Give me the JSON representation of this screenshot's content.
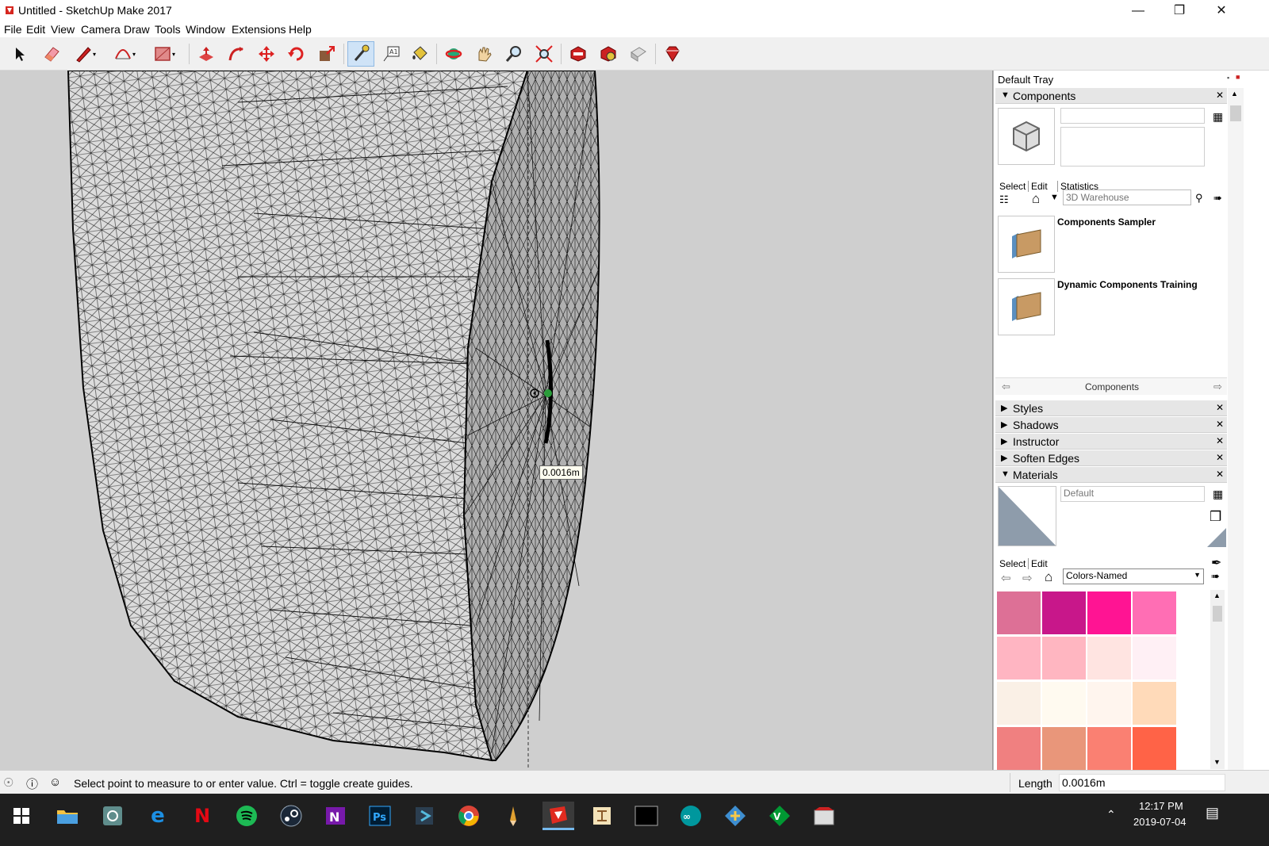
{
  "window": {
    "title": "Untitled - SketchUp Make 2017",
    "minimize_icon": "minimize-icon",
    "maximize_icon": "restore-icon",
    "close_icon": "close-icon"
  },
  "menu": [
    "File",
    "Edit",
    "View",
    "Camera",
    "Draw",
    "Tools",
    "Window",
    "Extensions",
    "Help"
  ],
  "toolbar": {
    "tools": [
      "select",
      "eraser",
      "pencil-line",
      "arc",
      "rectangle",
      "push-pull",
      "follow-me",
      "move",
      "rotate",
      "scale",
      "tape-measure",
      "text",
      "paint-bucket",
      "orbit",
      "pan",
      "zoom",
      "zoom-extents",
      "3d-warehouse",
      "extension-warehouse",
      "layout",
      "ruby"
    ],
    "active_tool": "tape-measure"
  },
  "viewport": {
    "measure_value": "0.0016m"
  },
  "tray": {
    "title": "Default Tray",
    "components": {
      "header": "Components",
      "tabs": [
        "Select",
        "Edit",
        "Statistics"
      ],
      "search_placeholder": "3D Warehouse",
      "items": [
        {
          "name": "Components Sampler"
        },
        {
          "name": "Dynamic Components Training"
        }
      ],
      "footer_label": "Components"
    },
    "collapsed_panels": [
      "Styles",
      "Shadows",
      "Instructor",
      "Soften Edges"
    ],
    "materials": {
      "header": "Materials",
      "name_value": "Default",
      "tabs": [
        "Select",
        "Edit"
      ],
      "library": "Colors-Named",
      "swatches": [
        "#dd7096",
        "#c8178a",
        "#ff1493",
        "#ff6eb4",
        "#ffb5c2",
        "#ffb6c1",
        "#ffe4e1",
        "#fff0f5",
        "#faf0e6",
        "#fffaf0",
        "#fff5ee",
        "#ffdab9",
        "#f08080",
        "#e9967a",
        "#fa8072",
        "#ff6347"
      ]
    }
  },
  "status": {
    "message": "Select point to measure to or enter value.  Ctrl = toggle create guides.",
    "length_label": "Length",
    "length_value": "0.0016m"
  },
  "taskbar": {
    "apps": [
      "start",
      "file-explorer",
      "app-settings",
      "edge",
      "netflix",
      "spotify",
      "steam",
      "onenote",
      "photoshop",
      "sourcetree",
      "chrome",
      "pencil",
      "sketchup",
      "app-diagram",
      "terminal",
      "arduino",
      "git-extensions",
      "vim",
      "app-archive"
    ],
    "active_app": "sketchup",
    "time": "12:17 PM",
    "date": "2019-07-04"
  }
}
